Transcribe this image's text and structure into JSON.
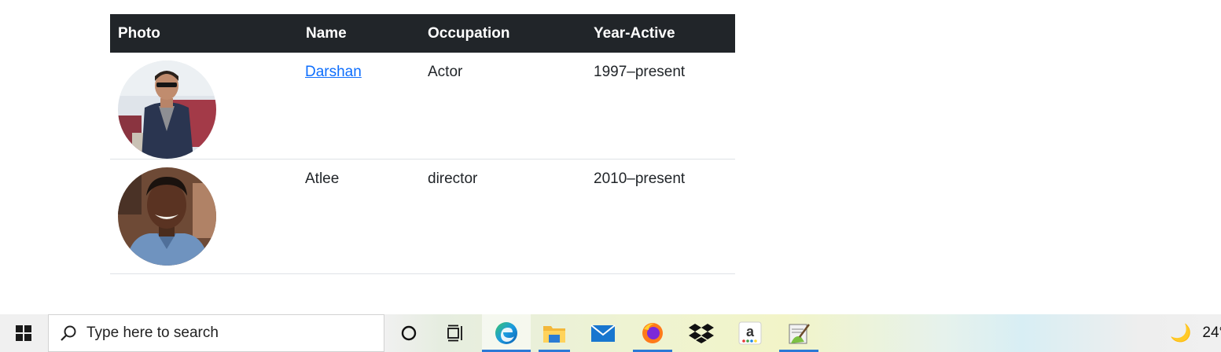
{
  "table": {
    "headers": [
      "Photo",
      "Name",
      "Occupation",
      "Year-Active"
    ],
    "rows": [
      {
        "name": "Darshan",
        "occupation": "Actor",
        "years": "1997–present"
      },
      {
        "name": "Atlee",
        "occupation": "director",
        "years": "2010–present"
      }
    ]
  },
  "taskbar": {
    "search_placeholder": "Type here to search",
    "apps": [
      "cortana-icon",
      "task-view-icon",
      "edge-icon",
      "file-explorer-icon",
      "mail-icon",
      "firefox-icon",
      "dropbox-icon",
      "amazon-icon",
      "notepadpp-icon"
    ],
    "weather_temp": "24°",
    "accent_color": "#2b79d6"
  }
}
